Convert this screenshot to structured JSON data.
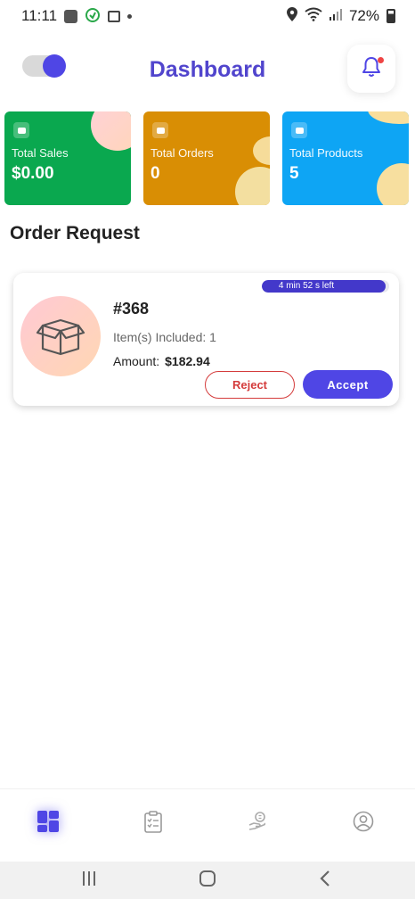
{
  "status_bar": {
    "time": "11:11",
    "battery": "72%"
  },
  "header": {
    "title": "Dashboard",
    "toggle_on": true
  },
  "stats": [
    {
      "label": "Total Sales",
      "value": "$0.00",
      "color": "#0aa84f"
    },
    {
      "label": "Total Orders",
      "value": "0",
      "color": "#d98e04"
    },
    {
      "label": "Total Products",
      "value": "5",
      "color": "#0ea5f4"
    }
  ],
  "section_title": "Order Request",
  "order": {
    "timer_text": "4 min 52 s left",
    "timer_remaining_fraction": 0.97,
    "id": "#368",
    "items_label": "Item(s) Included: 1",
    "amount_label": "Amount:",
    "amount_value": "$182.94",
    "reject_label": "Reject",
    "accept_label": "Accept"
  },
  "tabs": [
    {
      "icon": "dashboard-icon",
      "active": true
    },
    {
      "icon": "orders-clipboard-icon",
      "active": false
    },
    {
      "icon": "payment-hand-icon",
      "active": false
    },
    {
      "icon": "profile-icon",
      "active": false
    }
  ],
  "colors": {
    "accent": "#4f46e5",
    "title": "#5145cd",
    "reject": "#d43b3b"
  }
}
